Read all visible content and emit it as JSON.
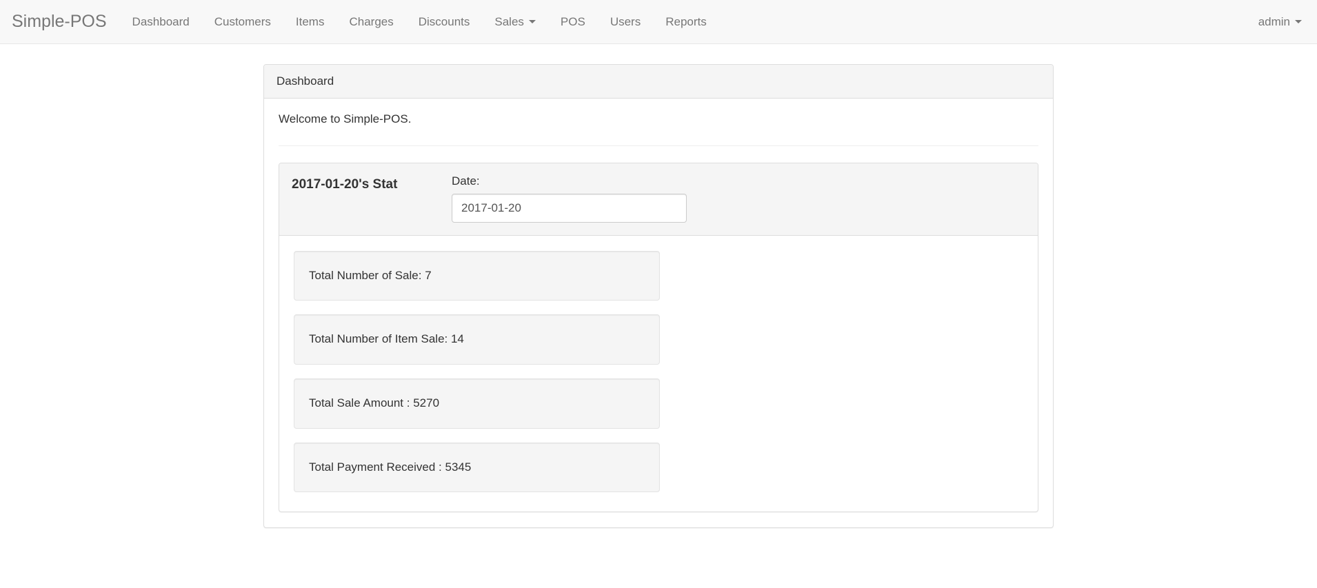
{
  "navbar": {
    "brand": "Simple-POS",
    "items": [
      {
        "label": "Dashboard",
        "has_caret": false
      },
      {
        "label": "Customers",
        "has_caret": false
      },
      {
        "label": "Items",
        "has_caret": false
      },
      {
        "label": "Charges",
        "has_caret": false
      },
      {
        "label": "Discounts",
        "has_caret": false
      },
      {
        "label": "Sales",
        "has_caret": true
      },
      {
        "label": "POS",
        "has_caret": false
      },
      {
        "label": "Users",
        "has_caret": false
      },
      {
        "label": "Reports",
        "has_caret": false
      }
    ],
    "user": {
      "label": "admin",
      "has_caret": true
    }
  },
  "panel": {
    "heading": "Dashboard",
    "welcome": "Welcome to Simple-POS."
  },
  "stat_panel": {
    "title": "2017-01-20's Stat",
    "date_label": "Date:",
    "date_value": "2017-01-20",
    "date_placeholder": "",
    "stats": [
      {
        "label": "Total Number of Sale: 7"
      },
      {
        "label": "Total Number of Item Sale: 14"
      },
      {
        "label": "Total Sale Amount : 5270"
      },
      {
        "label": "Total Payment Received : 5345"
      }
    ]
  },
  "colors": {
    "navbar_bg": "#f8f8f8",
    "navbar_border": "#e7e7e7",
    "nav_text": "#777777",
    "panel_border": "#dddddd",
    "panel_heading_bg": "#f5f5f5",
    "well_bg": "#f5f5f5",
    "well_border": "#e3e3e3",
    "body_text": "#333333",
    "input_border": "#cccccc",
    "divider": "#eeeeee"
  }
}
